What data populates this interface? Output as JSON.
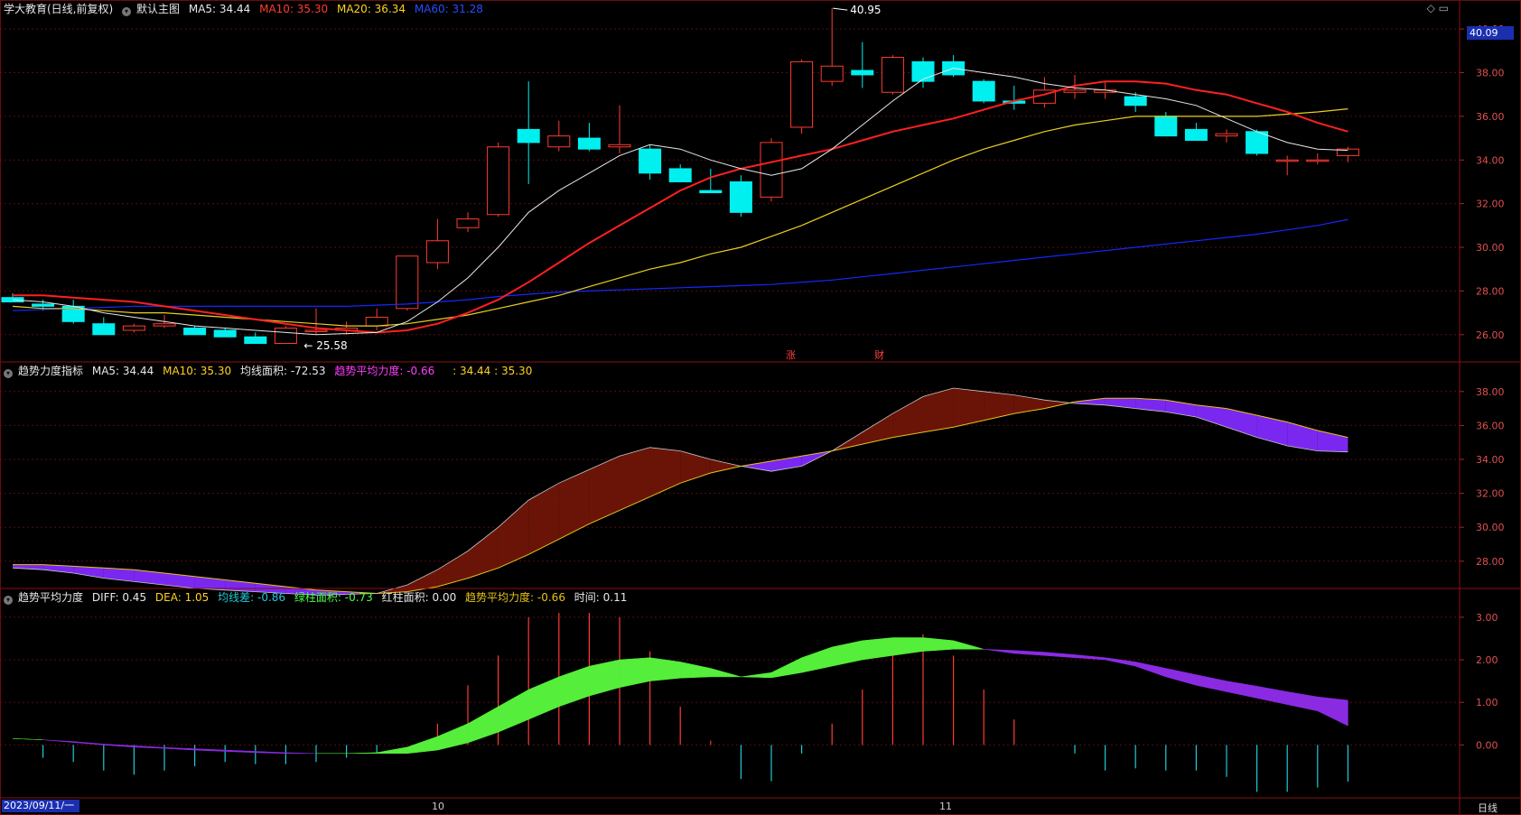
{
  "title_bar": {
    "stock": "学大教育(日线,前复权)",
    "main_label": "默认主图",
    "ma5": "MA5: 34.44",
    "ma10": "MA10: 35.30",
    "ma20": "MA20: 36.34",
    "ma60": "MA60: 31.28",
    "controls": "◇ ▭",
    "current_price": "40.09"
  },
  "panel2_header": {
    "name": "趋势力度指标",
    "ma5": "MA5: 34.44",
    "ma10": "MA10: 35.30",
    "area": "均线面积: -72.53",
    "avg_force": "趋势平均力度: -0.66",
    "pair": ": 34.44 : 35.30"
  },
  "panel3_header": {
    "name": "趋势平均力度",
    "diff": "DIFF: 0.45",
    "dea": "DEA: 1.05",
    "line_gap": "均线差: -0.86",
    "green_area": "绿柱面积: -0.73",
    "red_area": "红柱面积: 0.00",
    "avg_force": "趋势平均力度: -0.66",
    "time": "时间: 0.11"
  },
  "annotations": {
    "high": "40.95",
    "low": "25.58",
    "event1": "涨",
    "event2": "财"
  },
  "x_axis": {
    "start_date": "2023/09/11/一",
    "labels": [
      "10",
      "11"
    ],
    "period": "日线"
  },
  "colors": {
    "up": "#ff3b30",
    "down": "#00f0f0",
    "ma5": "#e8e8e8",
    "ma10": "#ff2020",
    "ma20": "#e8d020",
    "ma60": "#1428ff",
    "fill_up": "#6a1408",
    "fill_down": "#7a28f0",
    "bar_green": "#55ee3a",
    "bar_purple": "#8a2be2"
  },
  "chart_data": [
    {
      "type": "candlestick",
      "ylim": [
        25,
        40.5
      ],
      "yticks": [
        "40.00",
        "38.00",
        "36.00",
        "34.00",
        "32.00",
        "30.00",
        "28.00",
        "26.00"
      ],
      "ohlc": [
        [
          27.7,
          27.9,
          27.5,
          27.5
        ],
        [
          27.4,
          27.6,
          27.1,
          27.3
        ],
        [
          27.3,
          27.6,
          26.5,
          26.6
        ],
        [
          26.5,
          26.8,
          26.0,
          26.0
        ],
        [
          26.2,
          26.5,
          26.1,
          26.4
        ],
        [
          26.4,
          26.9,
          26.3,
          26.5
        ],
        [
          26.3,
          26.4,
          26.0,
          26.0
        ],
        [
          26.2,
          26.3,
          25.9,
          25.9
        ],
        [
          25.9,
          26.1,
          25.6,
          25.6
        ],
        [
          25.6,
          26.4,
          25.58,
          26.3
        ],
        [
          26.2,
          27.2,
          26.0,
          26.2
        ],
        [
          26.2,
          26.6,
          26.0,
          26.3
        ],
        [
          26.4,
          27.2,
          26.2,
          26.8
        ],
        [
          27.2,
          29.6,
          27.1,
          29.6
        ],
        [
          29.3,
          31.3,
          29.0,
          30.3
        ],
        [
          30.9,
          31.6,
          30.7,
          31.3
        ],
        [
          31.5,
          34.8,
          31.4,
          34.6
        ],
        [
          35.4,
          37.6,
          32.9,
          34.8
        ],
        [
          34.6,
          35.8,
          34.4,
          35.1
        ],
        [
          35.0,
          35.7,
          34.4,
          34.5
        ],
        [
          34.6,
          36.5,
          34.3,
          34.7
        ],
        [
          34.5,
          34.7,
          33.1,
          33.4
        ],
        [
          33.6,
          33.8,
          33.0,
          33.0
        ],
        [
          32.6,
          33.6,
          32.5,
          32.5
        ],
        [
          33.0,
          33.3,
          31.4,
          31.6
        ],
        [
          32.3,
          35.0,
          32.1,
          34.8
        ],
        [
          35.5,
          38.6,
          35.2,
          38.5
        ],
        [
          37.6,
          40.95,
          37.4,
          38.3
        ],
        [
          38.1,
          39.4,
          37.3,
          37.9
        ],
        [
          37.1,
          38.8,
          37.0,
          38.7
        ],
        [
          38.5,
          38.7,
          37.3,
          37.6
        ],
        [
          38.5,
          38.8,
          37.8,
          37.9
        ],
        [
          37.6,
          37.7,
          36.6,
          36.7
        ],
        [
          36.7,
          37.4,
          36.3,
          36.6
        ],
        [
          36.6,
          37.8,
          36.4,
          37.2
        ],
        [
          37.1,
          37.9,
          36.8,
          37.2
        ],
        [
          37.1,
          37.6,
          36.8,
          37.2
        ],
        [
          36.9,
          37.1,
          36.2,
          36.5
        ],
        [
          36.0,
          36.2,
          35.1,
          35.1
        ],
        [
          35.4,
          35.7,
          35.0,
          34.9
        ],
        [
          35.1,
          35.4,
          34.8,
          35.2
        ],
        [
          35.3,
          35.4,
          34.2,
          34.3
        ],
        [
          34.0,
          34.2,
          33.3,
          34.0
        ],
        [
          34.0,
          34.3,
          33.8,
          34.0
        ],
        [
          34.2,
          34.6,
          33.9,
          34.5
        ]
      ],
      "ma5": [
        27.6,
        27.5,
        27.3,
        27.0,
        26.8,
        26.6,
        26.4,
        26.3,
        26.2,
        26.1,
        26.0,
        26.05,
        26.1,
        26.6,
        27.5,
        28.6,
        30.0,
        31.6,
        32.6,
        33.4,
        34.2,
        34.7,
        34.5,
        34.0,
        33.6,
        33.3,
        33.6,
        34.5,
        35.6,
        36.7,
        37.7,
        38.2,
        38.0,
        37.8,
        37.5,
        37.3,
        37.2,
        37.0,
        36.8,
        36.5,
        35.9,
        35.3,
        34.8,
        34.5,
        34.44
      ],
      "ma10": [
        27.8,
        27.8,
        27.7,
        27.6,
        27.5,
        27.3,
        27.1,
        26.9,
        26.7,
        26.5,
        26.3,
        26.2,
        26.1,
        26.2,
        26.5,
        27.0,
        27.6,
        28.4,
        29.3,
        30.2,
        31.0,
        31.8,
        32.6,
        33.2,
        33.6,
        33.9,
        34.2,
        34.5,
        34.9,
        35.3,
        35.6,
        35.9,
        36.3,
        36.7,
        37.0,
        37.4,
        37.6,
        37.6,
        37.5,
        37.2,
        37.0,
        36.6,
        36.2,
        35.7,
        35.3
      ],
      "ma20": [
        27.3,
        27.2,
        27.2,
        27.1,
        27.0,
        27.0,
        26.9,
        26.8,
        26.7,
        26.6,
        26.5,
        26.4,
        26.4,
        26.5,
        26.7,
        26.9,
        27.2,
        27.5,
        27.8,
        28.2,
        28.6,
        29.0,
        29.3,
        29.7,
        30.0,
        30.5,
        31.0,
        31.6,
        32.2,
        32.8,
        33.4,
        34.0,
        34.5,
        34.9,
        35.3,
        35.6,
        35.8,
        36.0,
        36.0,
        36.0,
        36.0,
        36.0,
        36.1,
        36.2,
        36.34
      ],
      "ma60": [
        27.1,
        27.15,
        27.2,
        27.25,
        27.3,
        27.3,
        27.3,
        27.3,
        27.3,
        27.3,
        27.3,
        27.3,
        27.35,
        27.4,
        27.5,
        27.6,
        27.75,
        27.85,
        27.95,
        28.0,
        28.05,
        28.1,
        28.15,
        28.2,
        28.25,
        28.3,
        28.4,
        28.5,
        28.65,
        28.8,
        28.95,
        29.1,
        29.25,
        29.4,
        29.55,
        29.7,
        29.85,
        30.0,
        30.15,
        30.3,
        30.45,
        30.6,
        30.8,
        31.0,
        31.28
      ]
    },
    {
      "type": "area",
      "ylim": [
        26.5,
        39.0
      ],
      "yticks": [
        "38.00",
        "36.00",
        "34.00",
        "32.00",
        "30.00",
        "28.00"
      ]
    },
    {
      "type": "bar",
      "ylim": [
        -1.2,
        3.4
      ],
      "yticks": [
        "3.00",
        "2.00",
        "1.00",
        "0.00"
      ],
      "diff": [
        0.15,
        0.12,
        0.06,
        0.0,
        -0.05,
        -0.08,
        -0.12,
        -0.15,
        -0.18,
        -0.2,
        -0.2,
        -0.2,
        -0.18,
        -0.05,
        0.2,
        0.5,
        0.9,
        1.3,
        1.6,
        1.85,
        2.0,
        2.05,
        1.95,
        1.8,
        1.6,
        1.7,
        2.05,
        2.3,
        2.45,
        2.52,
        2.52,
        2.45,
        2.25,
        2.15,
        2.1,
        2.05,
        2.0,
        1.85,
        1.6,
        1.4,
        1.25,
        1.1,
        0.95,
        0.8,
        0.45
      ],
      "dea": [
        0.15,
        0.12,
        0.08,
        0.02,
        -0.02,
        -0.06,
        -0.09,
        -0.12,
        -0.15,
        -0.18,
        -0.2,
        -0.2,
        -0.2,
        -0.2,
        -0.12,
        0.05,
        0.3,
        0.6,
        0.9,
        1.15,
        1.35,
        1.5,
        1.57,
        1.6,
        1.6,
        1.58,
        1.7,
        1.85,
        2.0,
        2.1,
        2.2,
        2.25,
        2.25,
        2.22,
        2.18,
        2.12,
        2.05,
        1.95,
        1.8,
        1.65,
        1.5,
        1.38,
        1.25,
        1.13,
        1.05
      ],
      "bars": [
        0.0,
        -0.3,
        -0.4,
        -0.6,
        -0.7,
        -0.6,
        -0.5,
        -0.4,
        -0.45,
        -0.45,
        -0.4,
        -0.3,
        -0.2,
        0.0,
        0.5,
        1.4,
        2.1,
        3.0,
        3.1,
        3.1,
        3.0,
        2.2,
        0.9,
        0.1,
        -0.8,
        -0.85,
        -0.2,
        0.5,
        1.3,
        2.4,
        2.6,
        2.1,
        1.3,
        0.6,
        0.0,
        -0.2,
        -0.6,
        -0.55,
        -0.6,
        -0.6,
        -0.75,
        -1.1,
        -1.1,
        -1.0,
        -0.86
      ]
    }
  ]
}
